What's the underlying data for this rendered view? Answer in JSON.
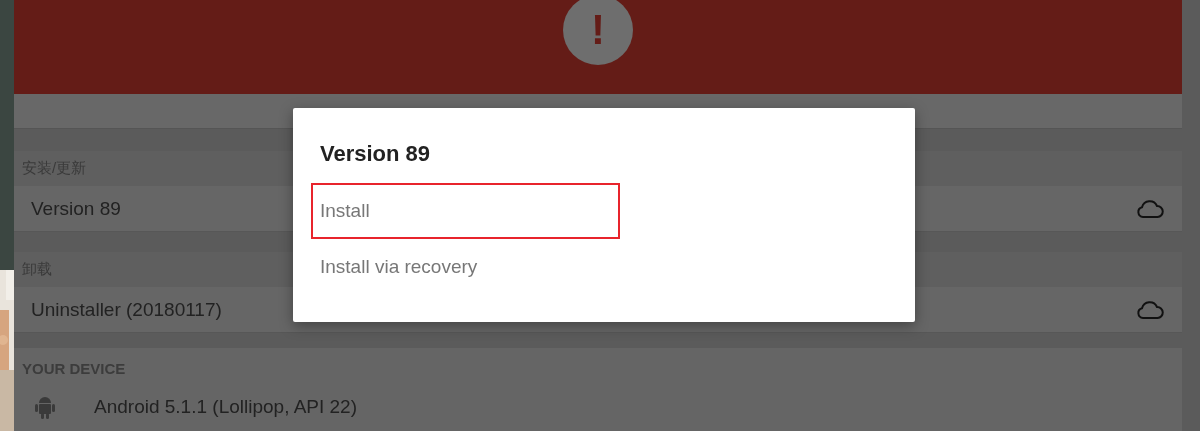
{
  "banner": {
    "icon": "!"
  },
  "sections": [
    {
      "label": "安装/更新",
      "value": "Version 89"
    },
    {
      "label": "卸载",
      "value": "Uninstaller (20180117)"
    }
  ],
  "device": {
    "heading": "YOUR DEVICE",
    "os": "Android 5.1.1 (Lollipop, API 22)"
  },
  "dialog": {
    "title": "Version 89",
    "options": [
      {
        "label": "Install",
        "highlighted": true
      },
      {
        "label": "Install via recovery",
        "highlighted": false
      }
    ]
  }
}
